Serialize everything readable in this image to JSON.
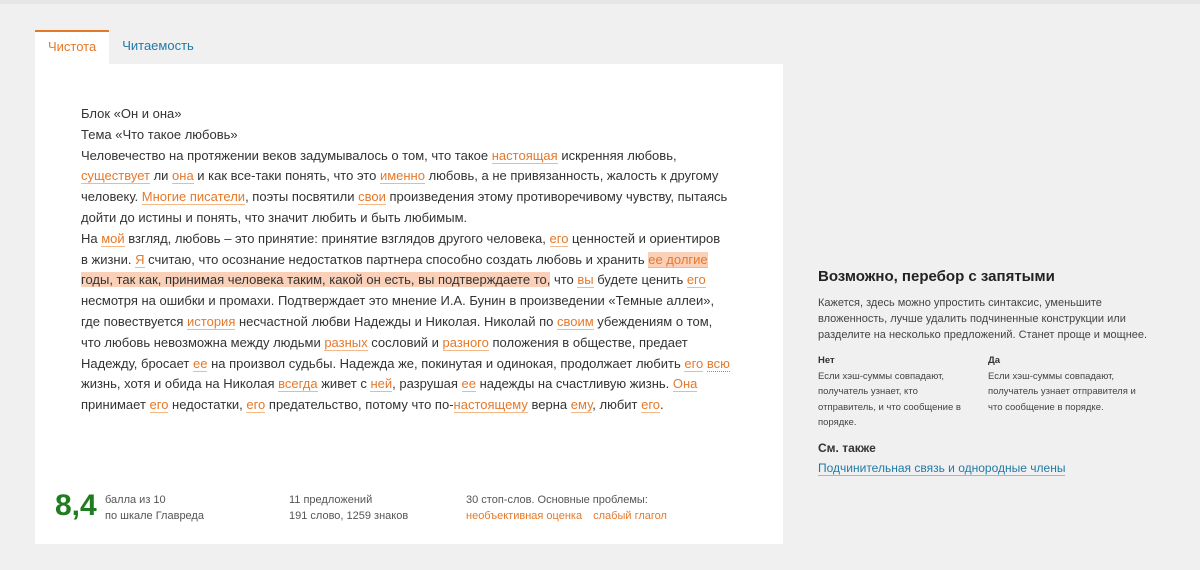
{
  "tabs": [
    {
      "label": "Чистота",
      "active": true
    },
    {
      "label": "Читаемость",
      "active": false
    }
  ],
  "text": {
    "line1": "Блок «Он и она»",
    "line2": "Тема «Что такое любовь»",
    "line3": [
      "Человечество на протяжении веков задумывалось о том, что такое ",
      "настоящая",
      " искренняя любовь,"
    ],
    "line4": [
      "существует",
      " ли ",
      "она",
      " и как все-таки понять, что это ",
      "именно",
      " любовь, а не привязанность, жалость к другому"
    ],
    "line5": [
      "человеку. ",
      "Многие писатели",
      ", поэты посвятили ",
      "свои",
      " произведения этому противоречивому чувству, пытаясь"
    ],
    "line6": "дойти до истины и понять, что значит любить и быть любимым.",
    "line7": [
      "На ",
      "мой",
      " взгляд, любовь – это принятие: принятие взглядов другого человека, ",
      "его",
      " ценностей и ориентиров"
    ],
    "line8": [
      "в жизни. ",
      "Я",
      " считаю, что осознание недостатков партнера способно создать любовь и хранить ",
      "ее долгие"
    ],
    "line9": [
      "годы, так как, принимая человека таким, какой он есть, вы подтверждаете то,",
      " что ",
      "вы",
      " будете ценить ",
      "его"
    ],
    "line10": "несмотря на ошибки и промахи. Подтверждает это мнение И.А. Бунин в произведении «Темные аллеи»,",
    "line11": [
      "где повествуется ",
      "история",
      " несчастной любви Надежды и Николая. Николай по ",
      "своим",
      " убеждениям о том,"
    ],
    "line12": [
      "что любовь невозможна между людьми ",
      "разных",
      " сословий и ",
      "разного",
      " положения в обществе, предает"
    ],
    "line13": [
      "Надежду, бросает ",
      "ее",
      " на произвол судьбы. Надежда же, покинутая и одинокая, продолжает любить ",
      "его",
      " ",
      "всю"
    ],
    "line14": [
      "жизнь, хотя и обида на Николая ",
      "всегда",
      " живет с ",
      "ней",
      ", разрушая ",
      "ее",
      " надежды на счастливую жизнь. ",
      "Она"
    ],
    "line15": [
      "принимает ",
      "его",
      " недостатки, ",
      "его",
      " предательство, потому что по-",
      "настоящему",
      " верна ",
      "ему",
      ", любит ",
      "его",
      "."
    ]
  },
  "stats": {
    "score": "8,4",
    "score_label1": "балла из 10",
    "score_label2": "по шкале Главреда",
    "sentences": "11 предложений",
    "words": "191 слово, 1259 знаков",
    "stopwords": "30 стоп-слов. Основные проблемы:",
    "problems": [
      "необъективная оценка",
      "слабый глагол"
    ]
  },
  "sidebar": {
    "title": "Возможно, перебор с запятыми",
    "description": "Кажется, здесь можно упростить синтаксис, уменьшите вложенность, лучше удалить подчиненные конструкции или разделите на несколько предложений. Станет проще и мощнее.",
    "no_header": "Нет",
    "no_text": "Если хэш-суммы совпадают, получатель узнает, кто отправитель, и что сообщение в порядке.",
    "yes_header": "Да",
    "yes_text": "Если хэш-суммы совпадают, получатель узнает отправителя и что сообщение в порядке.",
    "see_also": "См. также",
    "link": "Подчинительная связь и однородные члены"
  },
  "colors": {
    "accent": "#e5792a",
    "link": "#1f7aa8",
    "score": "#1f7c1f",
    "selection": "#fbd0b9"
  }
}
